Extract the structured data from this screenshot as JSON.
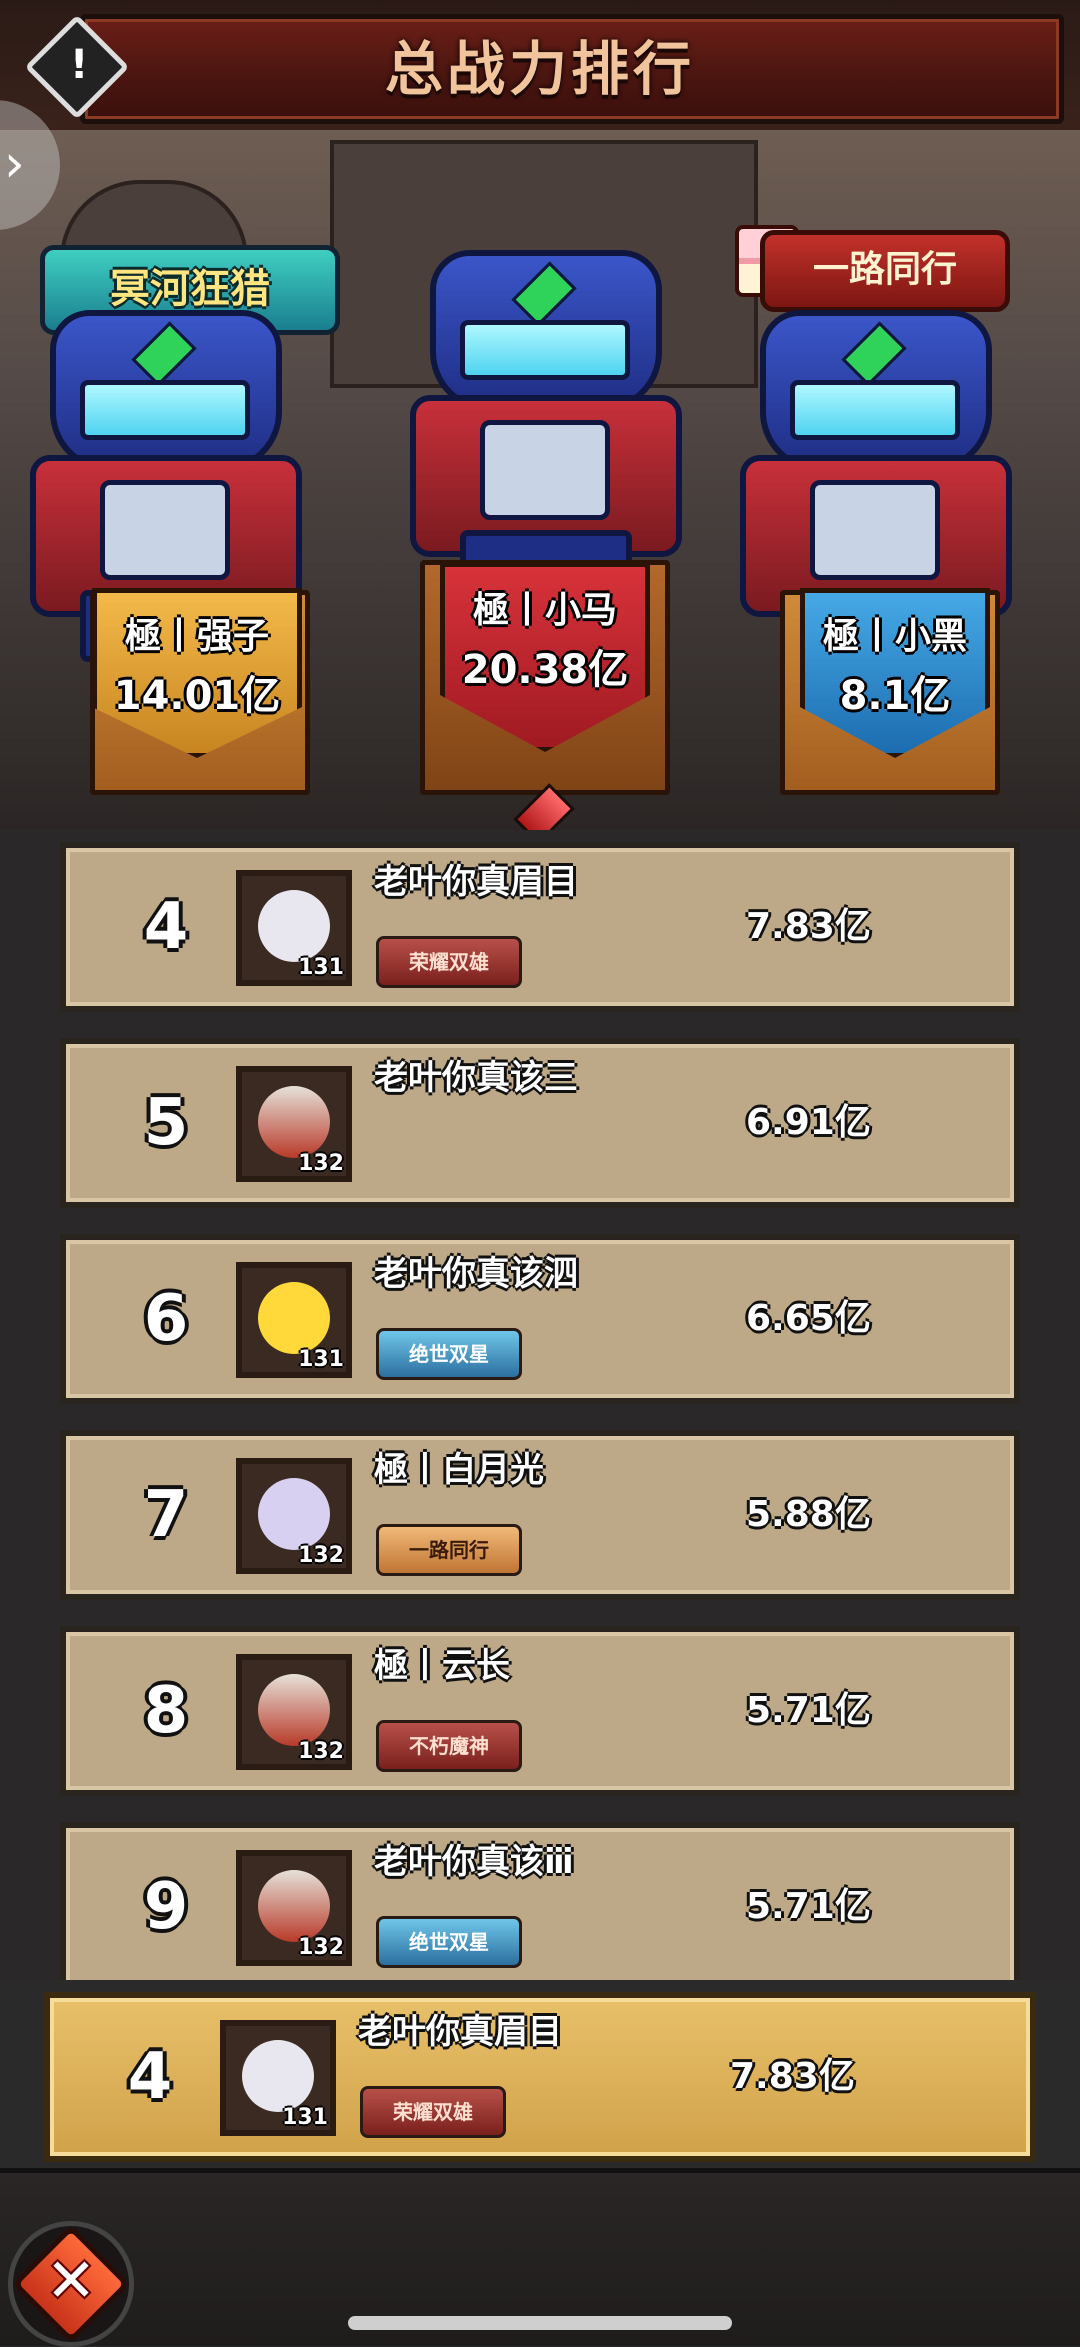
{
  "header": {
    "title": "总战力排行"
  },
  "podium": {
    "first": {
      "rank": 1,
      "name": "極丨小马",
      "power": "20.38亿"
    },
    "second": {
      "rank": 2,
      "name": "極丨强子",
      "power": "14.01亿",
      "title": "冥河狂猎"
    },
    "third": {
      "rank": 3,
      "name": "極丨小黑",
      "power": "8.1亿",
      "title": "一路同行"
    }
  },
  "ranking": [
    {
      "rank": "4",
      "name": "老叶你真眉目",
      "level": "131",
      "power": "7.83亿",
      "badge": "荣耀双雄",
      "avatar": "white-warrior",
      "badge_style": "red"
    },
    {
      "rank": "5",
      "name": "老叶你真该三",
      "level": "132",
      "power": "6.91亿",
      "badge": "",
      "avatar": "horned-demon",
      "badge_style": ""
    },
    {
      "rank": "6",
      "name": "老叶你真该泗",
      "level": "131",
      "power": "6.65亿",
      "badge": "绝世双星",
      "avatar": "yellow-beast",
      "badge_style": "blue"
    },
    {
      "rank": "7",
      "name": "極丨白月光",
      "level": "132",
      "power": "5.88亿",
      "badge": "一路同行",
      "avatar": "purple-rabbit",
      "badge_style": "orange"
    },
    {
      "rank": "8",
      "name": "極丨云长",
      "level": "132",
      "power": "5.71亿",
      "badge": "不朽魔神",
      "avatar": "horned-demon",
      "badge_style": "red"
    },
    {
      "rank": "9",
      "name": "老叶你真该ⅲ",
      "level": "132",
      "power": "5.71亿",
      "badge": "绝世双星",
      "avatar": "horned-demon",
      "badge_style": "blue"
    }
  ],
  "my_rank": {
    "rank": "4",
    "name": "老叶你真眉目",
    "level": "131",
    "power": "7.83亿",
    "badge": "荣耀双雄",
    "avatar": "white-warrior"
  },
  "colors": {
    "row_bg": "#bda887",
    "my_row_bg": "#e8c06a",
    "header_red": "#4a1510"
  },
  "icons": {
    "info": "warning-diamond-icon",
    "close": "close-x-icon",
    "side": "chevron-right-icon"
  }
}
